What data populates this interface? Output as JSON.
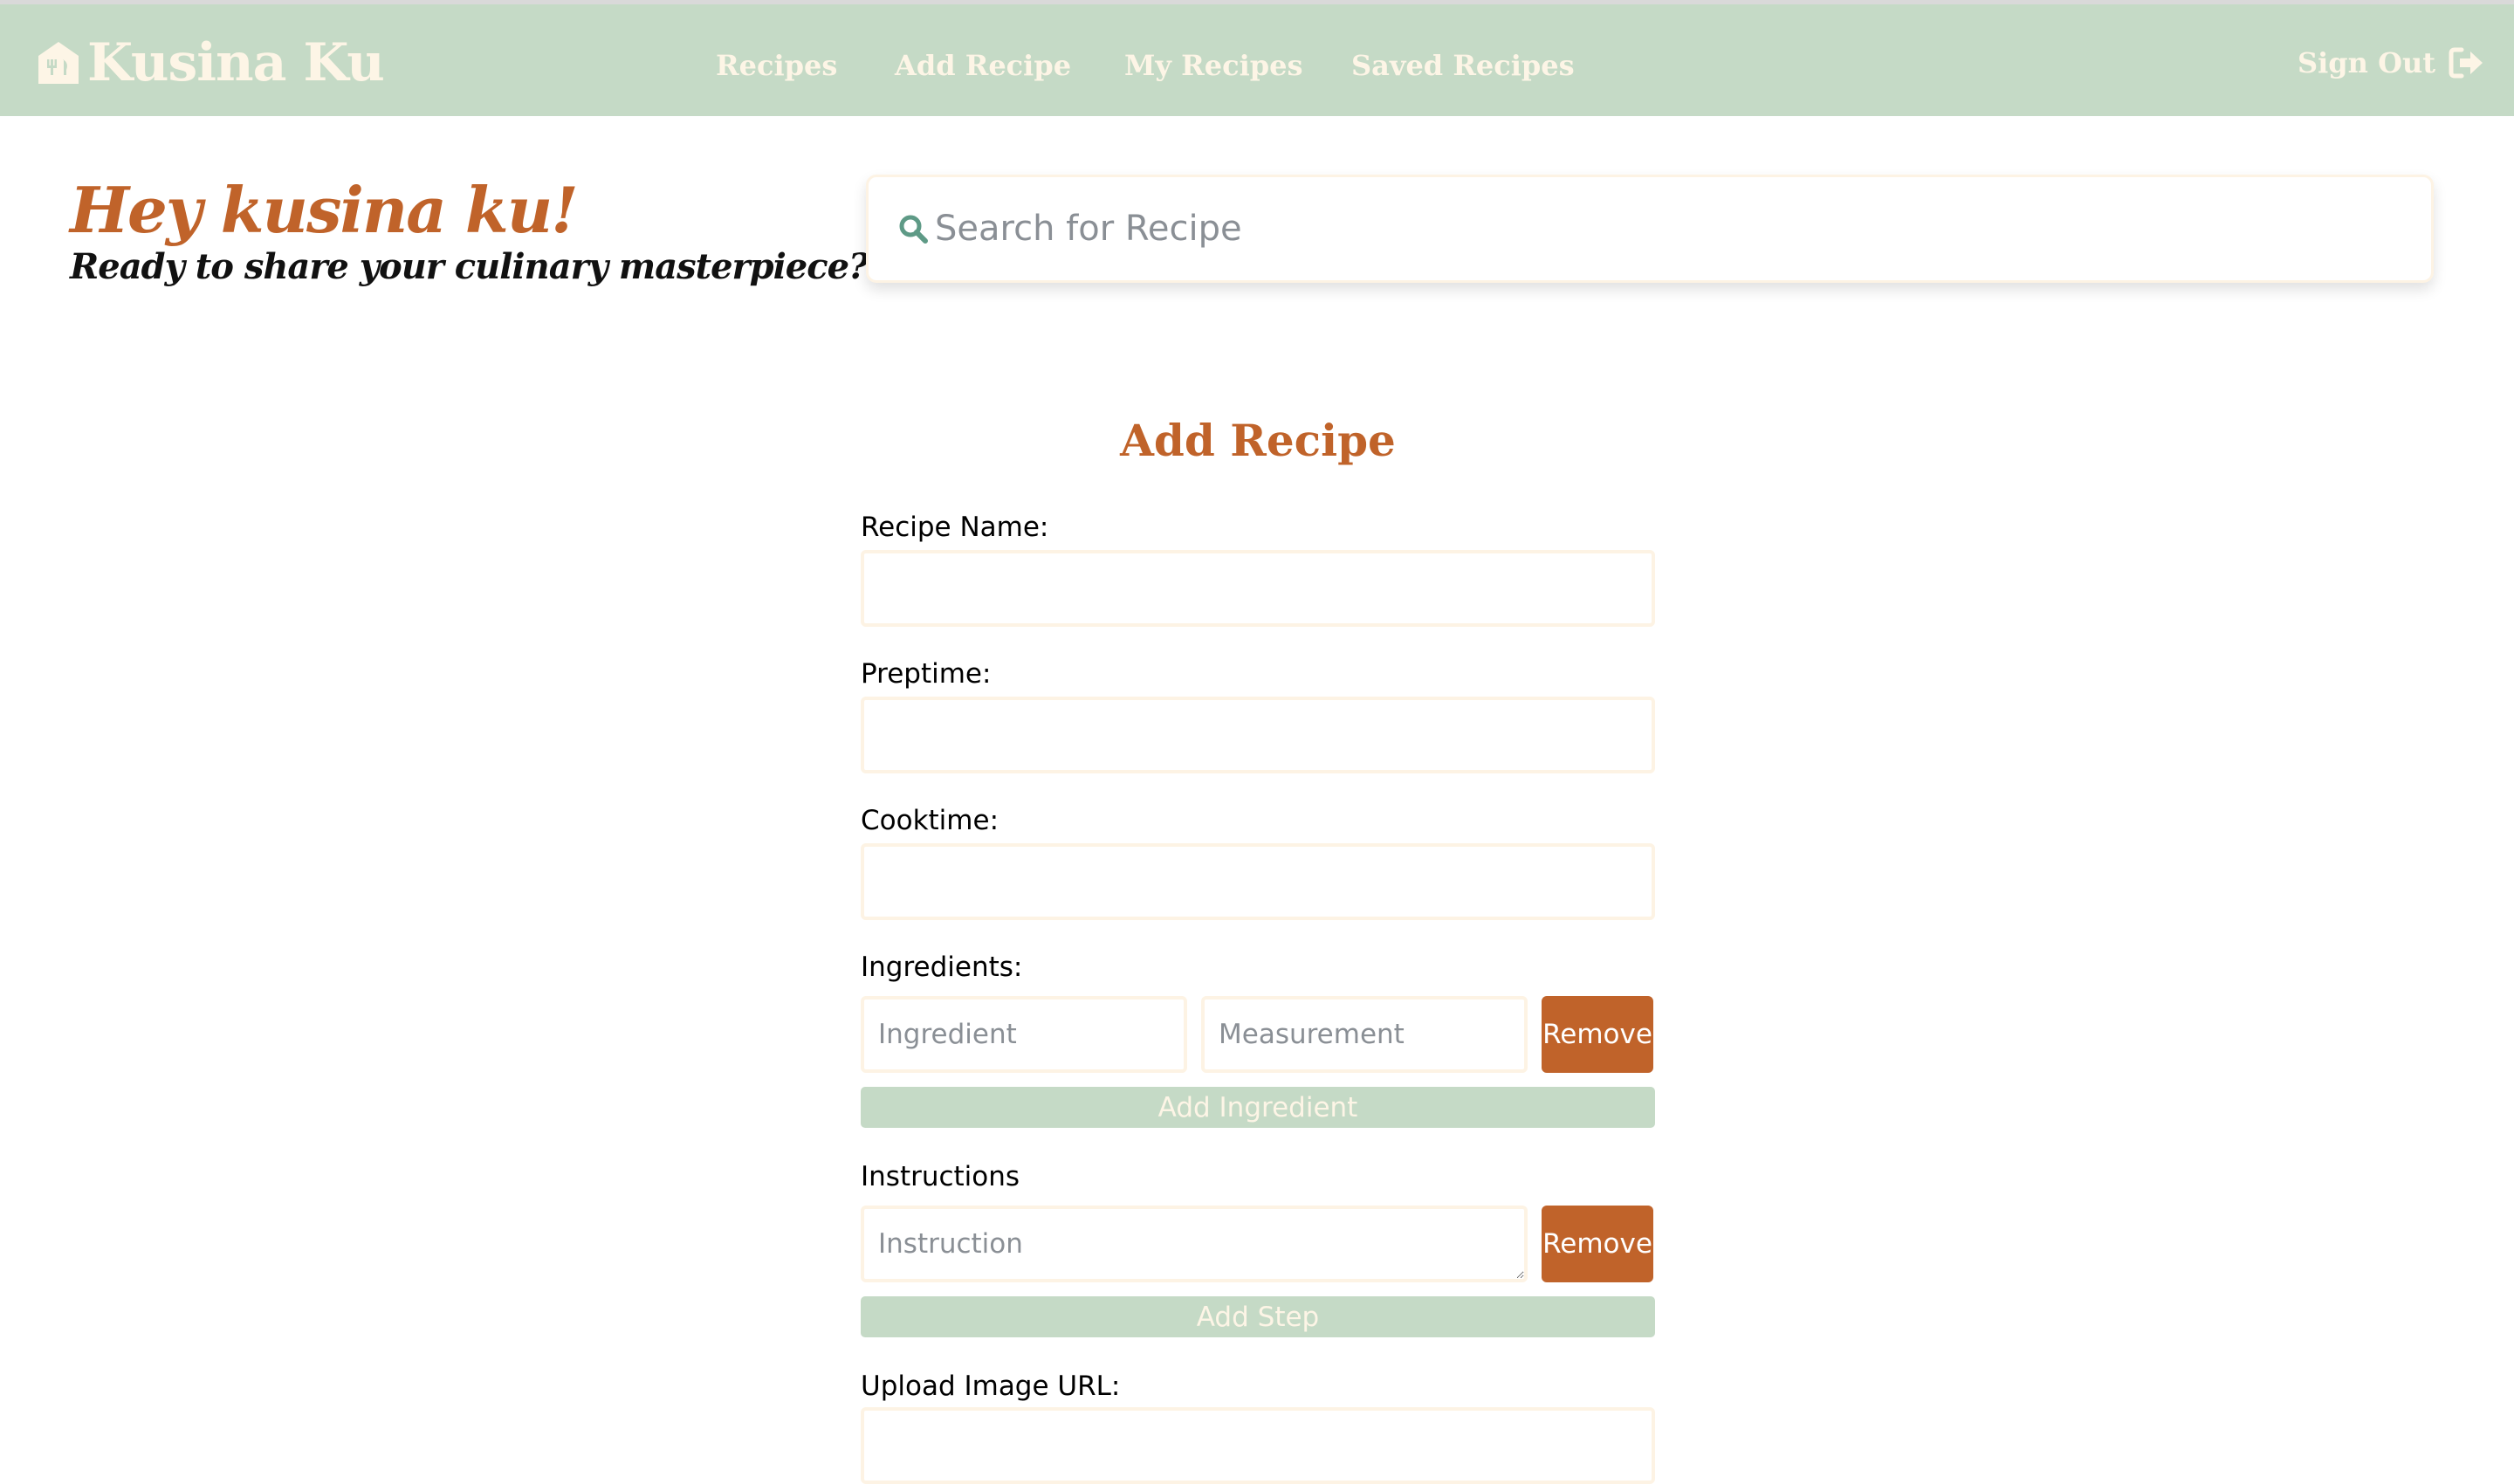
{
  "navbar": {
    "brand": "Kusina Ku",
    "links": [
      {
        "label": "Recipes"
      },
      {
        "label": "Add Recipe"
      },
      {
        "label": "My Recipes"
      },
      {
        "label": "Saved Recipes"
      }
    ],
    "sign_out": "Sign Out",
    "background_color": "#c5dac6",
    "text_color": "#fdf5e6"
  },
  "header": {
    "greeting": "Hey kusina ku!",
    "subtitle": "Ready to share your culinary masterpiece?",
    "accent_color": "#c0632a"
  },
  "search": {
    "placeholder": "Search for Recipe",
    "value": ""
  },
  "form": {
    "title": "Add Recipe",
    "recipe_name": {
      "label": "Recipe Name:",
      "value": ""
    },
    "preptime": {
      "label": "Preptime:",
      "value": ""
    },
    "cooktime": {
      "label": "Cooktime:",
      "value": ""
    },
    "ingredients": {
      "label": "Ingredients:",
      "rows": [
        {
          "ingredient_placeholder": "Ingredient",
          "measurement_placeholder": "Measurement",
          "remove_label": "Remove"
        }
      ],
      "add_label": "Add Ingredient"
    },
    "instructions": {
      "label": "Instructions",
      "rows": [
        {
          "placeholder": "Instruction",
          "remove_label": "Remove"
        }
      ],
      "add_label": "Add Step"
    },
    "image_url": {
      "label": "Upload Image URL:",
      "value": ""
    }
  },
  "icons": {
    "brand": "home-utensils-icon",
    "sign_out": "sign-out-icon",
    "search": "search-icon"
  }
}
